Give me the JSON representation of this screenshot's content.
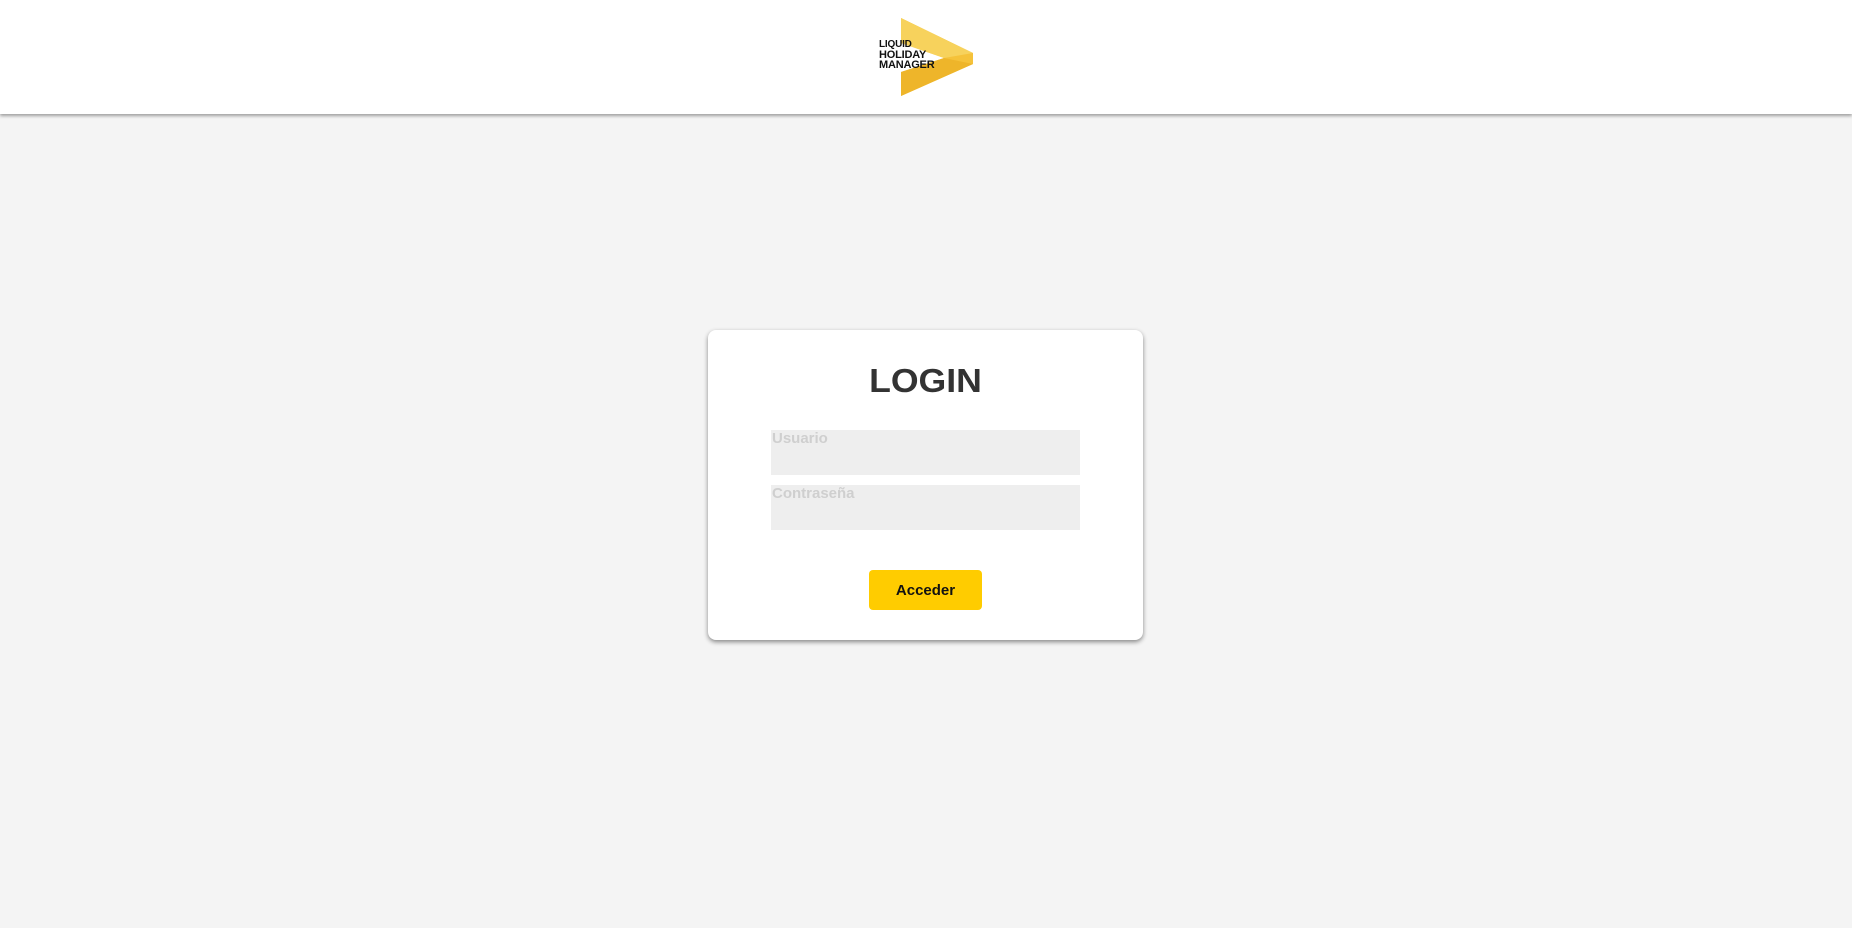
{
  "header": {
    "logo": {
      "line1": "LIQUID",
      "line2": "HOLIDAY",
      "line3": "MANAGER",
      "accent_color": "#f5c23a",
      "icon": "chevron-arrow-logo"
    }
  },
  "login": {
    "title": "LOGIN",
    "username_placeholder": "Usuario",
    "password_placeholder": "Contraseña",
    "submit_label": "Acceder",
    "button_color": "#ffcc00"
  }
}
